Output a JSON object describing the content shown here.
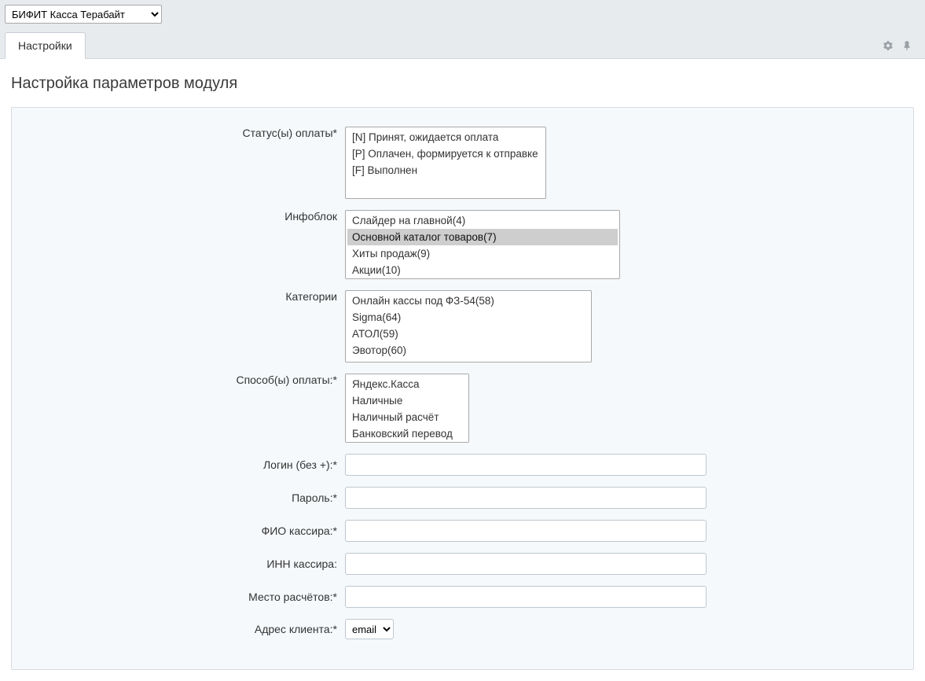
{
  "topbar": {
    "module_selected": "БИФИТ Касса Терабайт"
  },
  "tabs": [
    {
      "label": "Настройки",
      "active": true
    }
  ],
  "page_title": "Настройка параметров модуля",
  "form": {
    "status": {
      "label": "Статус(ы) оплаты*",
      "options": [
        "[N] Принят, ожидается оплата",
        "[P] Оплачен, формируется к отправке",
        "[F] Выполнен"
      ]
    },
    "infoblock": {
      "label": "Инфоблок",
      "options": [
        {
          "text": "Слайдер на главной(4)",
          "selected": false
        },
        {
          "text": "Основной каталог товаров(7)",
          "selected": true
        },
        {
          "text": "Хиты продаж(9)",
          "selected": false
        },
        {
          "text": "Акции(10)",
          "selected": false
        }
      ]
    },
    "categories": {
      "label": "Категории",
      "options": [
        "Онлайн кассы под ФЗ-54(58)",
        "Sigma(64)",
        "АТОЛ(59)",
        "Эвотор(60)"
      ]
    },
    "pay_methods": {
      "label": "Способ(ы) оплаты:*",
      "options": [
        "Яндекс.Касса",
        "Наличные",
        "Наличный расчёт",
        "Банковский перевод"
      ]
    },
    "login": {
      "label": "Логин (без +):*",
      "value": ""
    },
    "password": {
      "label": "Пароль:*",
      "value": ""
    },
    "cashier_name": {
      "label": "ФИО кассира:*",
      "value": ""
    },
    "cashier_inn": {
      "label": "ИНН кассира:",
      "value": ""
    },
    "settlement_place": {
      "label": "Место расчётов:*",
      "value": ""
    },
    "client_address": {
      "label": "Адрес клиента:*",
      "selected": "email"
    }
  }
}
